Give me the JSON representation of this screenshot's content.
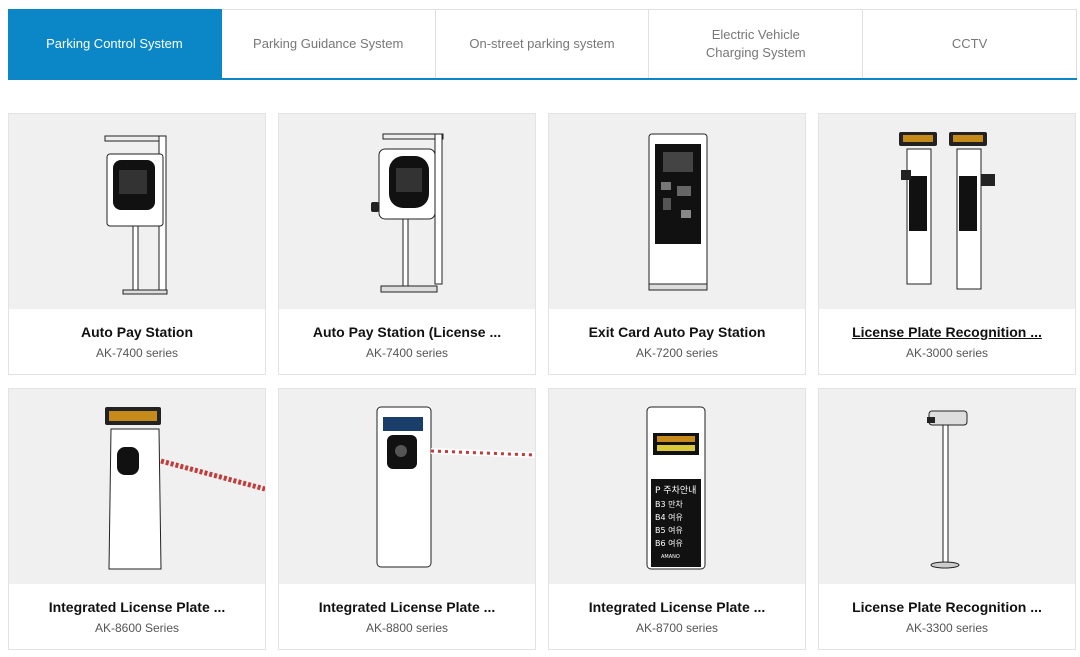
{
  "tabs": [
    {
      "label": "Parking Control System",
      "active": true
    },
    {
      "label": "Parking Guidance System",
      "active": false
    },
    {
      "label": "On-street parking system",
      "active": false
    },
    {
      "label_line1": "Electric Vehicle",
      "label_line2": "Charging System",
      "active": false
    },
    {
      "label": "CCTV",
      "active": false
    }
  ],
  "products": [
    {
      "name": "Auto Pay Station",
      "model": "AK-7400 series",
      "icon": "auto-pay-station-kiosk-icon"
    },
    {
      "name": "Auto Pay Station (License ...",
      "model": "AK-7400 series",
      "icon": "auto-pay-station-lpr-kiosk-icon"
    },
    {
      "name": "Exit Card Auto Pay Station",
      "model": "AK-7200 series",
      "icon": "exit-card-pay-station-icon"
    },
    {
      "name": "License Plate Recognition ...",
      "model": "AK-3000 series",
      "icon": "lpr-camera-posts-icon"
    },
    {
      "name": "Integrated License Plate ...",
      "model": "AK-8600 Series",
      "icon": "integrated-lpr-barrier-icon"
    },
    {
      "name": "Integrated License Plate ...",
      "model": "AK-8800 series",
      "icon": "integrated-lpr-barrier-icon"
    },
    {
      "name": "Integrated License Plate ...",
      "model": "AK-8700 series",
      "icon": "integrated-lpr-guidance-icon"
    },
    {
      "name": "License Plate Recognition ...",
      "model": "AK-3300 series",
      "icon": "lpr-camera-pole-icon"
    }
  ],
  "signs": {
    "p_label": "P 주차안내",
    "rows": [
      "B3 만차",
      "B4 여유",
      "B5 여유",
      "B6 여유"
    ],
    "brand": "AMANO"
  },
  "colors": {
    "accent": "#0b87c8",
    "card_bg": "#f0f0f0"
  }
}
